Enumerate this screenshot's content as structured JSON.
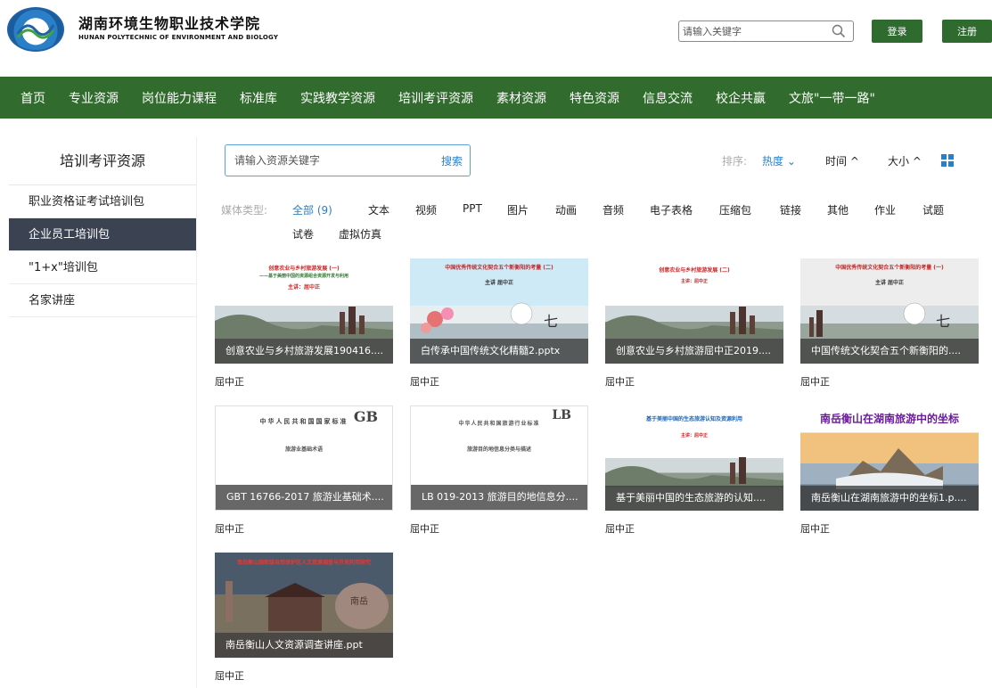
{
  "header": {
    "brand_cn": "湖南环境生物职业技术学院",
    "brand_en": "HUNAN POLYTECHNIC OF ENVIRONMENT AND BIOLOGY",
    "search_placeholder": "请输入关键字",
    "search_icon": "search-icon",
    "login_label": "登录",
    "register_label": "注册"
  },
  "nav": {
    "items": [
      "首页",
      "专业资源",
      "岗位能力课程",
      "标准库",
      "实践教学资源",
      "培训考评资源",
      "素材资源",
      "特色资源",
      "信息交流",
      "校企共赢",
      "文旅\"一带一路\""
    ]
  },
  "sidebar": {
    "title": "培训考评资源",
    "items": [
      "职业资格证考试培训包",
      "企业员工培训包",
      "\"1+x\"培训包",
      "名家讲座"
    ],
    "active_index": 1
  },
  "toolbar": {
    "search_placeholder": "请输入资源关键字",
    "search_button": "搜索",
    "sort_label": "排序:",
    "sort_hot": "热度 ⌄",
    "sort_time": "时间 ^",
    "sort_size": "大小 ^",
    "view_icon": "grid-view-icon"
  },
  "filter": {
    "label": "媒体类型:",
    "options": [
      "全部 (9)",
      "文本",
      "视频",
      "PPT",
      "图片",
      "动画",
      "音频",
      "电子表格",
      "压缩包",
      "链接",
      "其他",
      "作业",
      "试题",
      "试卷",
      "虚拟仿真"
    ],
    "selected_index": 0
  },
  "colors": {
    "nav_green": "#316b2e",
    "button_green": "#2f6b2f",
    "accent_blue": "#2a7fc6",
    "active_sidebar": "#3b4352"
  },
  "resources": [
    {
      "caption": "创意农业与乡村旅游发展190416....",
      "author": "屈中正",
      "thumb_title": "创意农业与乡村旅游发展 (一)",
      "thumb_sub": "——基于美丽中国的资源组合资源开发与利用",
      "thumb_speaker": "主讲：屈中正"
    },
    {
      "caption": "白传承中国传统文化精髓2.pptx",
      "author": "屈中正",
      "thumb_title": "中国优秀传统文化契合五个新衡阳的考量 (二)",
      "thumb_speaker": "主讲 屈中正"
    },
    {
      "caption": "创意农业与乡村旅游屈中正2019....",
      "author": "屈中正",
      "thumb_title": "创意农业与乡村旅游发展 (二)",
      "thumb_speaker": "主讲：屈中正"
    },
    {
      "caption": "中国传统文化契合五个新衡阳的....",
      "author": "屈中正",
      "thumb_title": "中国优秀传统文化契合五个新衡阳的考量 (一)",
      "thumb_speaker": "主讲 屈中正"
    },
    {
      "caption": "GBT 16766-2017 旅游业基础术....",
      "author": "屈中正",
      "thumb_title": "中华人民共和国国家标准",
      "thumb_code": "GB",
      "thumb_sub": "旅游业基础术语"
    },
    {
      "caption": "LB 019-2013 旅游目的地信息分....",
      "author": "屈中正",
      "thumb_title": "中华人民共和国旅游行业标准",
      "thumb_code": "LB",
      "thumb_sub": "旅游目的地信息分类与描述"
    },
    {
      "caption": "基于美丽中国的生态旅游的认知....",
      "author": "屈中正",
      "thumb_title": "基于美丽中国的生态旅游认知及资源利用",
      "thumb_speaker": "主讲：屈中正"
    },
    {
      "caption": "南岳衡山在湖南旅游中的坐标1.p....",
      "author": "屈中正",
      "thumb_title": "南岳衡山在湖南旅游中的坐标"
    },
    {
      "caption": "南岳衡山人文资源调查讲座.ppt",
      "author": "屈中正",
      "thumb_title": "南岳衡山国家级自然保护区人文资源调查与开发利用研究"
    }
  ]
}
